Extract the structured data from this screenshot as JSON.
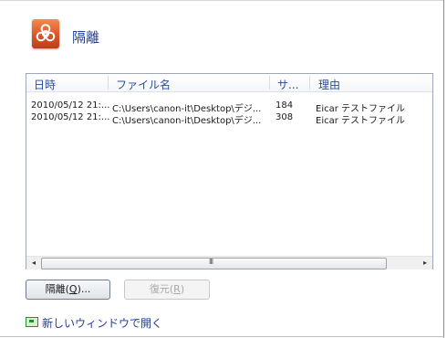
{
  "title": "隔離",
  "list": {
    "columns": [
      "日時",
      "ファイル名",
      "サ...",
      "理由"
    ],
    "rows": [
      {
        "date": "2010/05/12 21:...",
        "file": "C:\\Users\\canon-it\\Desktop\\デジ...",
        "size": "184",
        "reason": "Eicar テストファイル"
      },
      {
        "date": "2010/05/12 21:...",
        "file": "C:\\Users\\canon-it\\Desktop\\デジ...",
        "size": "308",
        "reason": "Eicar テストファイル"
      }
    ],
    "scrollbar": {
      "left_arrow": "◂",
      "right_arrow": "▸",
      "grip": "III"
    }
  },
  "buttons": {
    "quarantine_label": "隔離(",
    "quarantine_key": "Q",
    "quarantine_suffix": ")...",
    "restore_label": "復元(",
    "restore_key": "R",
    "restore_suffix": ")"
  },
  "footer": {
    "link_label": "新しいウィンドウで開く",
    "icon": "window-icon"
  },
  "colors": {
    "accent": "#1f3f8f",
    "icon_orange": "#e0622f"
  }
}
